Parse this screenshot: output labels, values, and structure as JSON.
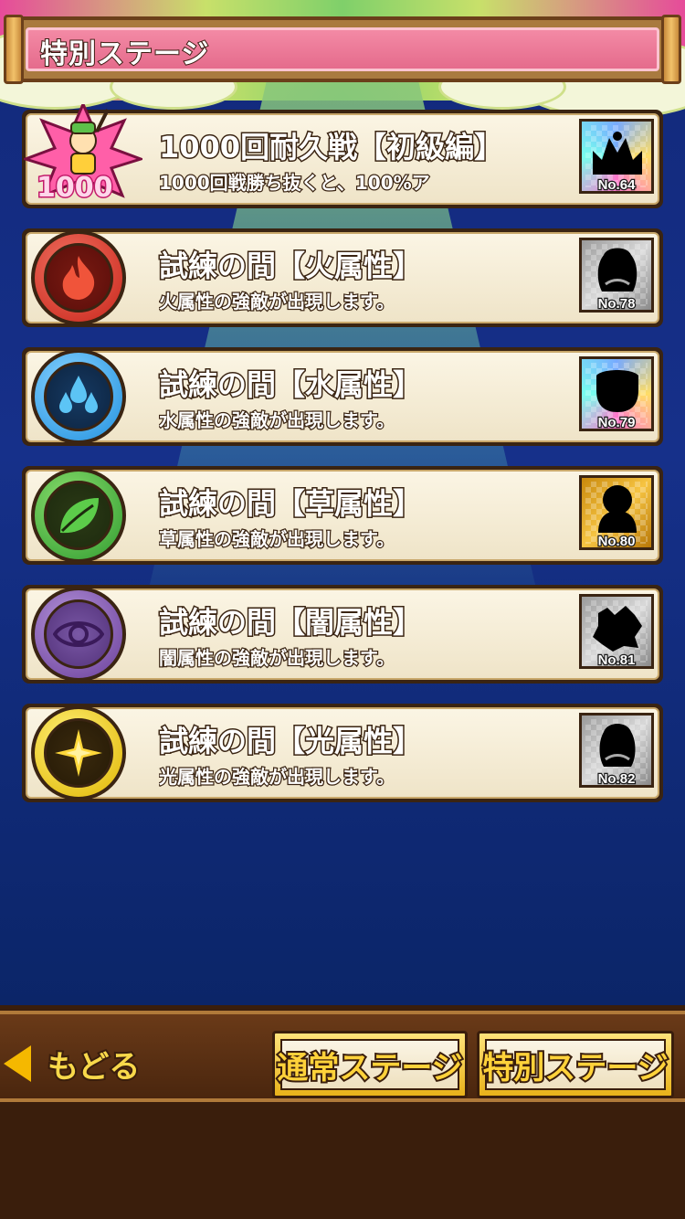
{
  "header": {
    "title": "特別ステージ"
  },
  "stages": [
    {
      "kind": "endurance",
      "title": "1000回耐久戦【初級編】",
      "desc": "1000回戦勝ち抜くと、100%ア",
      "thumb_no": "No.64",
      "thumb_style": "rainbow",
      "badge_text": "1000"
    },
    {
      "kind": "fire",
      "title": "試練の間【火属性】",
      "desc": "火属性の強敵が出現します。",
      "thumb_no": "No.78",
      "thumb_style": "gray"
    },
    {
      "kind": "water",
      "title": "試練の間【水属性】",
      "desc": "水属性の強敵が出現します。",
      "thumb_no": "No.79",
      "thumb_style": "rainbow"
    },
    {
      "kind": "grass",
      "title": "試練の間【草属性】",
      "desc": "草属性の強敵が出現します。",
      "thumb_no": "No.80",
      "thumb_style": "gold"
    },
    {
      "kind": "dark",
      "title": "試練の間【闇属性】",
      "desc": "闇属性の強敵が出現します。",
      "thumb_no": "No.81",
      "thumb_style": "gray"
    },
    {
      "kind": "light",
      "title": "試練の間【光属性】",
      "desc": "光属性の強敵が出現します。",
      "thumb_no": "No.82",
      "thumb_style": "gray"
    }
  ],
  "footer": {
    "back_label": "もどる",
    "normal_stage_label": "通常ステージ",
    "special_stage_label": "特別ステージ"
  },
  "colors": {
    "background": "#12297a",
    "header_pink": "#e56b8c",
    "card_cream": "#fbf5e4",
    "outline_brown": "#3a2412",
    "button_gold": "#ffd23a"
  }
}
